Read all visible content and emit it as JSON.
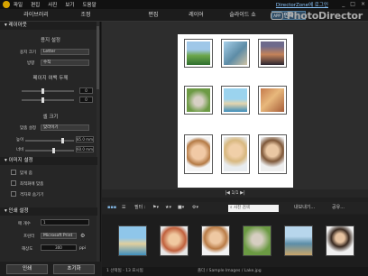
{
  "menu": {
    "items": [
      "파일",
      "편집",
      "사진",
      "보기",
      "도움말"
    ],
    "director_zone": "DirectorZone에 로그인"
  },
  "window_controls": [
    "_",
    "□",
    "×"
  ],
  "modes": [
    "라이브러리",
    "조정",
    "편집",
    "레이어",
    "슬라이드 쇼",
    "인쇄"
  ],
  "active_mode": "인쇄",
  "brand": {
    "app_button": "APP",
    "title": "PhotoDirector"
  },
  "layout": {
    "header": "레이아웃",
    "paper_settings_title": "용지 설정",
    "paper_size_label": "용지 크기",
    "paper_size_value": "Letter",
    "orientation_label": "방향",
    "orientation_value": "수직",
    "margins_title": "페이지 여백 두께",
    "margin_top_value": "0",
    "margin_bottom_value": "0",
    "cell_size_title": "셀 크기",
    "placement_label": "맞춤 설정",
    "placement_value": "맞라이기",
    "height_label": "높이",
    "height_value": "85.0 mm",
    "width_label": "너비",
    "width_value": "60.0 mm"
  },
  "image_settings": {
    "header": "이미지 설정",
    "options": [
      "맞게 줌",
      "최적화에 맞춤",
      "격자로 숨기기"
    ]
  },
  "print_settings": {
    "header": "인쇄 설정",
    "copies_label": "매 개수",
    "copies_value": "1",
    "printer_label": "프린터",
    "printer_value": "Microsoft Print",
    "resolution_label": "해상도",
    "resolution_value": "300",
    "resolution_unit": "ppi"
  },
  "actions": {
    "print": "인쇄",
    "reset": "초기화"
  },
  "pager": "|◀ 1/1 ▶|",
  "strip": {
    "filter_label": "필터 :",
    "search_placeholder": "사진 검색",
    "export_label": "내보내기...",
    "share_label": "공유..."
  },
  "status": {
    "left": "1 선택됨 - 13 표시됨",
    "path": "폴더 / Sample Images / Lake.jpg"
  },
  "colors": {
    "accent": "#324e65",
    "background": "#202020"
  }
}
